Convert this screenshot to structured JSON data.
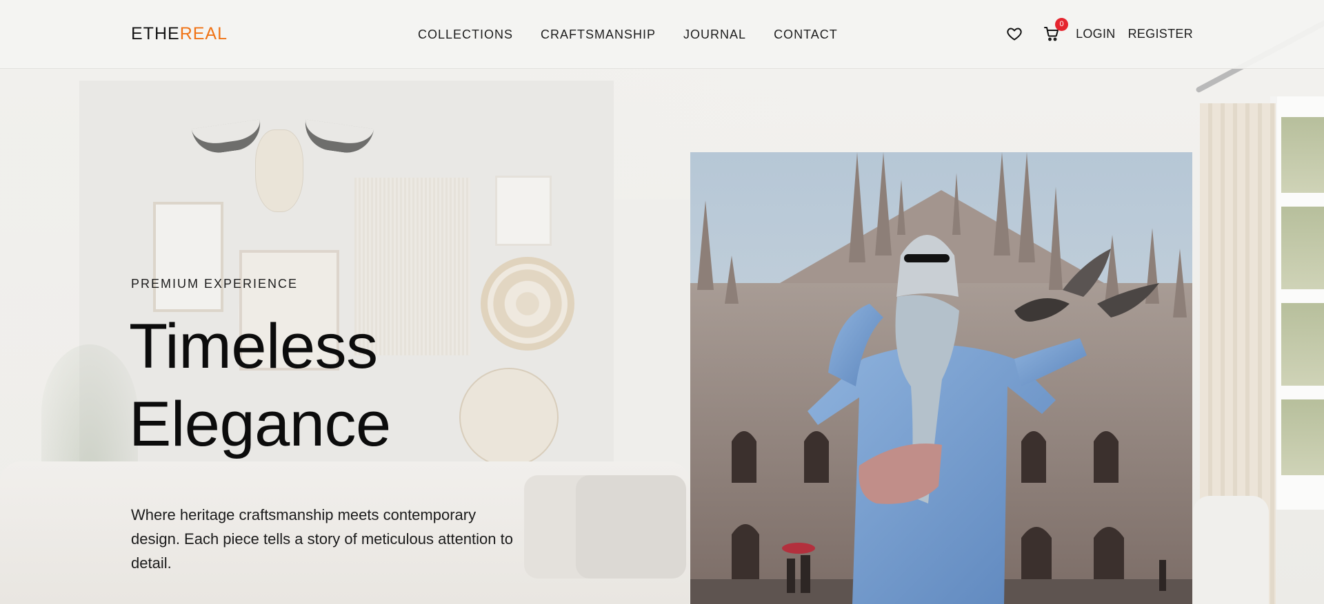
{
  "brand": {
    "part1": "ETHE",
    "part2": "REAL",
    "accent_color": "#f07316"
  },
  "nav": {
    "items": [
      {
        "label": "COLLECTIONS"
      },
      {
        "label": "CRAFTSMANSHIP"
      },
      {
        "label": "JOURNAL"
      },
      {
        "label": "CONTACT"
      }
    ]
  },
  "header_actions": {
    "wishlist_icon": "heart-icon",
    "cart_icon": "cart-icon",
    "cart_count": "0",
    "login_label": "LOGIN",
    "register_label": "REGISTER",
    "badge_color": "#e5252f"
  },
  "hero": {
    "eyebrow": "PREMIUM EXPERIENCE",
    "title_line1": "Timeless",
    "title_line2": "Elegance",
    "description": "Where heritage craftsmanship meets contemporary design. Each piece tells a story of meticulous attention to detail."
  }
}
